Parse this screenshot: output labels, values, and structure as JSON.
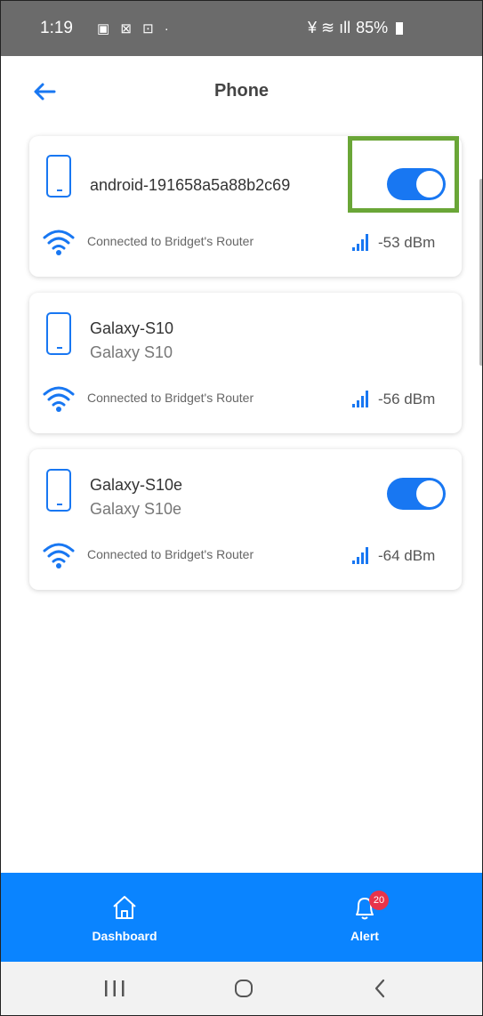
{
  "status_bar": {
    "time": "1:19",
    "left_icons": "▣ ⊠ ⊡ ·",
    "right_icons": "¥ ≋ ıll",
    "battery": "85%"
  },
  "header": {
    "title": "Phone",
    "back_icon": "back-arrow-icon"
  },
  "devices": [
    {
      "name": "android-191658a5a88b2c69",
      "subtitle": "",
      "connection": "Connected to Bridget's Router",
      "signal": "-53 dBm",
      "toggle_on": true
    },
    {
      "name": "Galaxy-S10",
      "subtitle": "Galaxy S10",
      "connection": "Connected to Bridget's Router",
      "signal": "-56 dBm",
      "toggle_on": false
    },
    {
      "name": "Galaxy-S10e",
      "subtitle": "Galaxy S10e",
      "connection": "Connected to Bridget's Router",
      "signal": "-64 dBm",
      "toggle_on": true
    }
  ],
  "bottom_nav": {
    "dashboard_label": "Dashboard",
    "alert_label": "Alert",
    "alert_badge": "20"
  },
  "colors": {
    "accent": "#1877f2",
    "nav_bg": "#0a84ff",
    "highlight": "#6aa637",
    "badge": "#e8334a"
  }
}
